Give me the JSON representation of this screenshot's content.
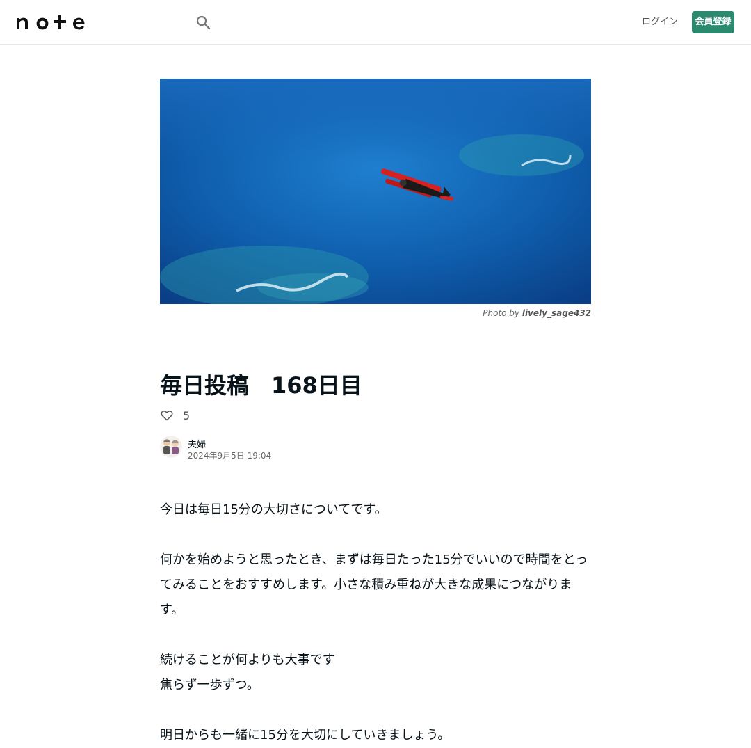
{
  "header": {
    "logo_text": "note",
    "search_icon": "search-icon",
    "login_label": "ログイン",
    "register_label": "会員登録"
  },
  "article": {
    "photo_credit_prefix": "Photo by",
    "photo_credit_user": "lively_sage432",
    "title": "毎日投稿　168日目",
    "like_icon": "heart-icon",
    "like_count": "5",
    "author_name": "夫婦",
    "date": "2024年9月5日 19:04",
    "paragraphs": [
      "今日は毎日15分の大切さについてです。",
      "",
      "何かを始めようと思ったとき、まずは毎日たった15分でいいので時間をとってみることをおすすめします。小さな積み重ねが大きな成果につながります。",
      "",
      "続けることが何よりも大事です",
      "焦らず一歩ずつ。",
      "",
      "明日からも一緒に15分を大切にしていきましょう。"
    ]
  },
  "colors": {
    "accent": "#2b8a6e",
    "text": "#08131a",
    "muted": "#666666"
  }
}
